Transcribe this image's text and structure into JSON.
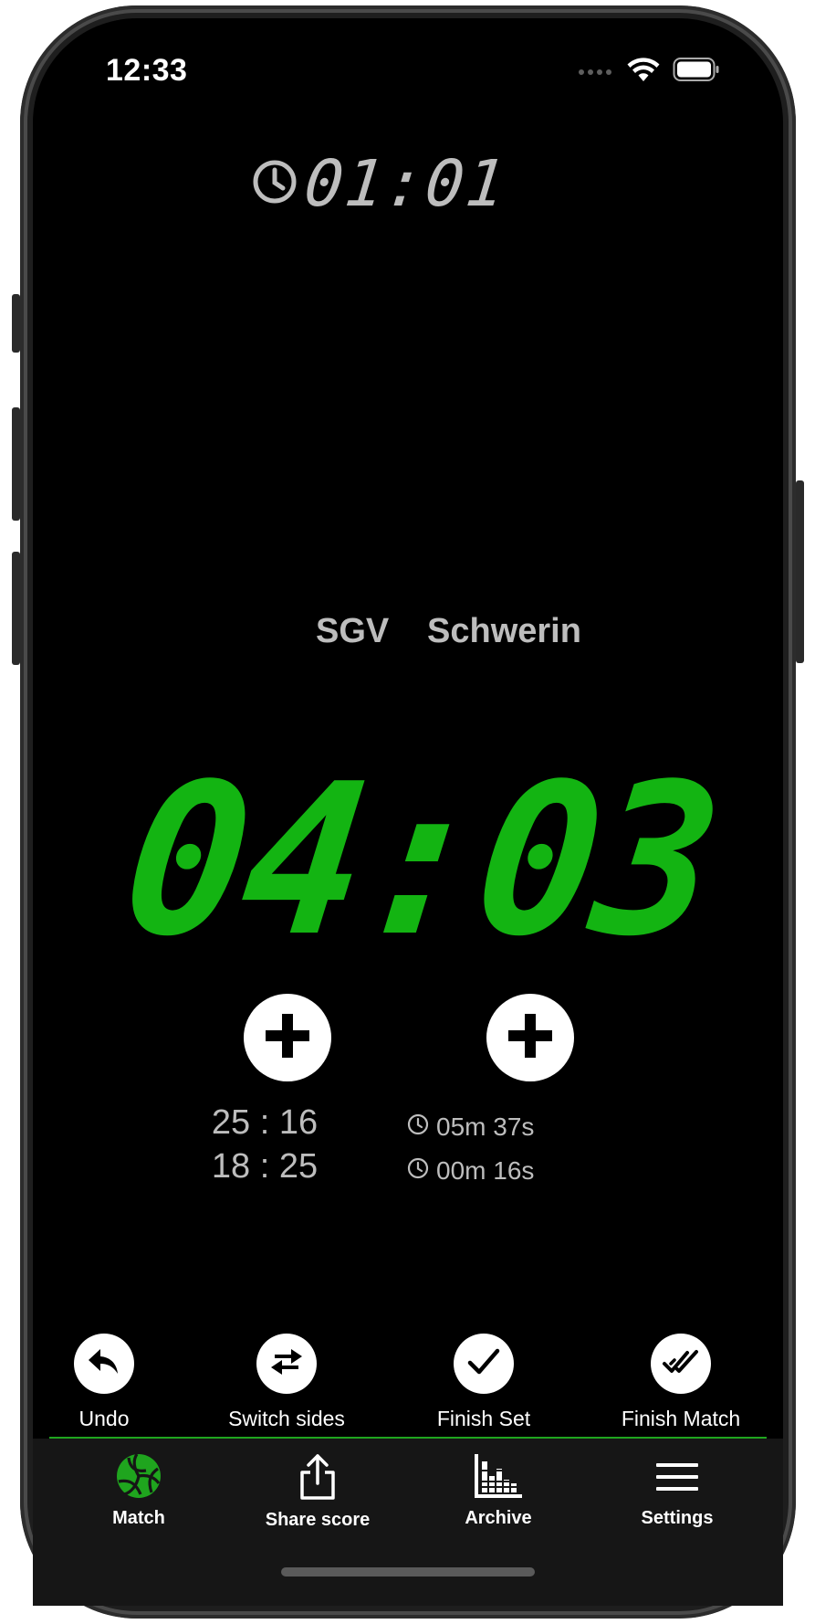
{
  "status_bar": {
    "time": "12:33",
    "icons": [
      "dots-icon",
      "wifi-icon",
      "battery-icon"
    ]
  },
  "match_clock": {
    "icon": "clock-icon",
    "value": "01:01"
  },
  "teams": {
    "left": "SGV",
    "right": "Schwerin"
  },
  "score": {
    "display": "04:03",
    "color": "#13b412"
  },
  "add_point": {
    "left_icon": "plus-icon",
    "right_icon": "plus-icon"
  },
  "set_results": [
    {
      "score": "25 : 16",
      "duration": "05m 37s"
    },
    {
      "score": "18 : 25",
      "duration": "00m 16s"
    }
  ],
  "actions": [
    {
      "label": "Undo",
      "icon": "undo-arrow-icon"
    },
    {
      "label": "Switch sides",
      "icon": "swap-arrows-icon"
    },
    {
      "label": "Finish Set",
      "icon": "checkmark-icon"
    },
    {
      "label": "Finish Match",
      "icon": "double-checkmark-icon"
    }
  ],
  "tabs": [
    {
      "label": "Match",
      "icon": "volleyball-icon",
      "active": true,
      "color": "#1fa51e"
    },
    {
      "label": "Share score",
      "icon": "share-icon",
      "active": false,
      "color": "#ffffff"
    },
    {
      "label": "Archive",
      "icon": "bar-chart-icon",
      "active": false,
      "color": "#ffffff"
    },
    {
      "label": "Settings",
      "icon": "menu-icon",
      "active": false,
      "color": "#ffffff"
    }
  ],
  "accent_color": "#1fa51e"
}
